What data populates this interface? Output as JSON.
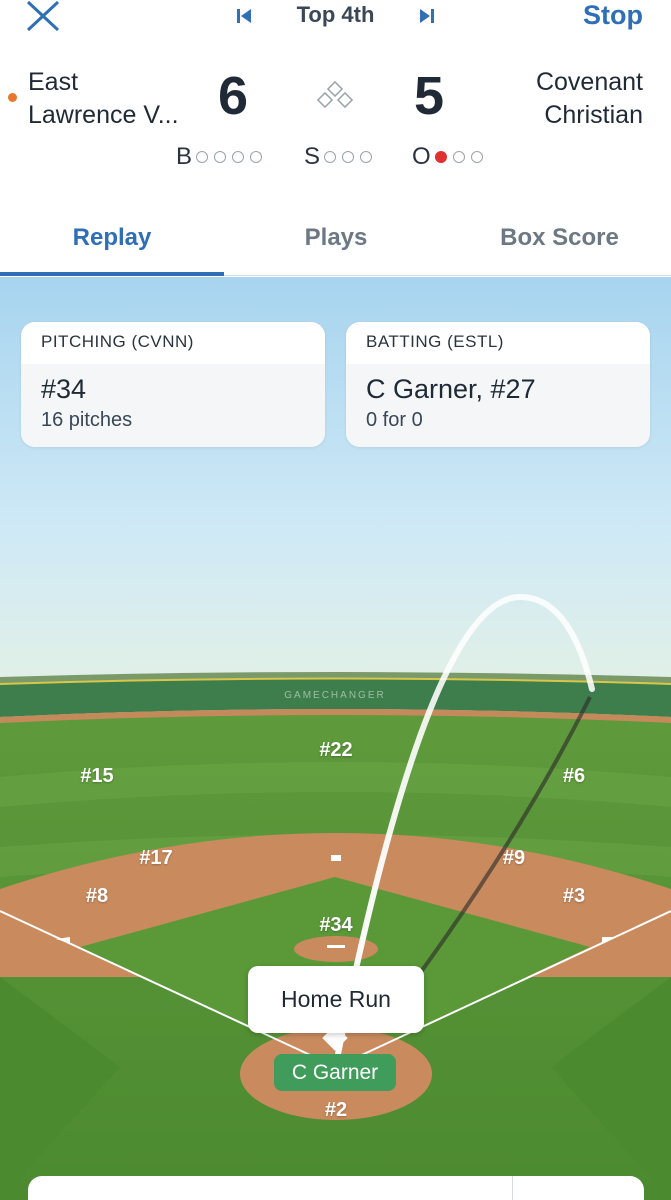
{
  "header": {
    "inning": "Top 4th",
    "stop_label": "Stop",
    "close_icon": "close-icon",
    "prev_icon": "skip-back-icon",
    "next_icon": "skip-forward-icon",
    "live_color": "#e8772e"
  },
  "teams": {
    "away": {
      "name_line1": "East",
      "name_line2": "Lawrence V...",
      "score": "6"
    },
    "home": {
      "name_line1": "Covenant",
      "name_line2": "Christian",
      "score": "5"
    }
  },
  "count": {
    "balls_label": "B",
    "balls": 0,
    "balls_max": 4,
    "strikes_label": "S",
    "strikes": 0,
    "strikes_max": 3,
    "outs_label": "O",
    "outs": 1,
    "outs_max": 3
  },
  "tabs": [
    {
      "label": "Replay",
      "active": true
    },
    {
      "label": "Plays",
      "active": false
    },
    {
      "label": "Box Score",
      "active": false
    }
  ],
  "pitching": {
    "title": "PITCHING (CVNN)",
    "player": "#34",
    "detail": "16 pitches"
  },
  "batting": {
    "title": "BATTING (ESTL)",
    "player": "C Garner, #27",
    "detail": "0 for 0"
  },
  "field": {
    "wall_text": "GAMECHANGER",
    "positions": {
      "lf": "#15",
      "cf": "#22",
      "rf": "#6",
      "ss": "#17",
      "second": "#9",
      "third": "#8",
      "first": "#3",
      "pitcher": "#34",
      "catcher": "#2"
    },
    "play_result": "Home Run",
    "batter": "C Garner",
    "accent_green": "#3f9c5a"
  }
}
